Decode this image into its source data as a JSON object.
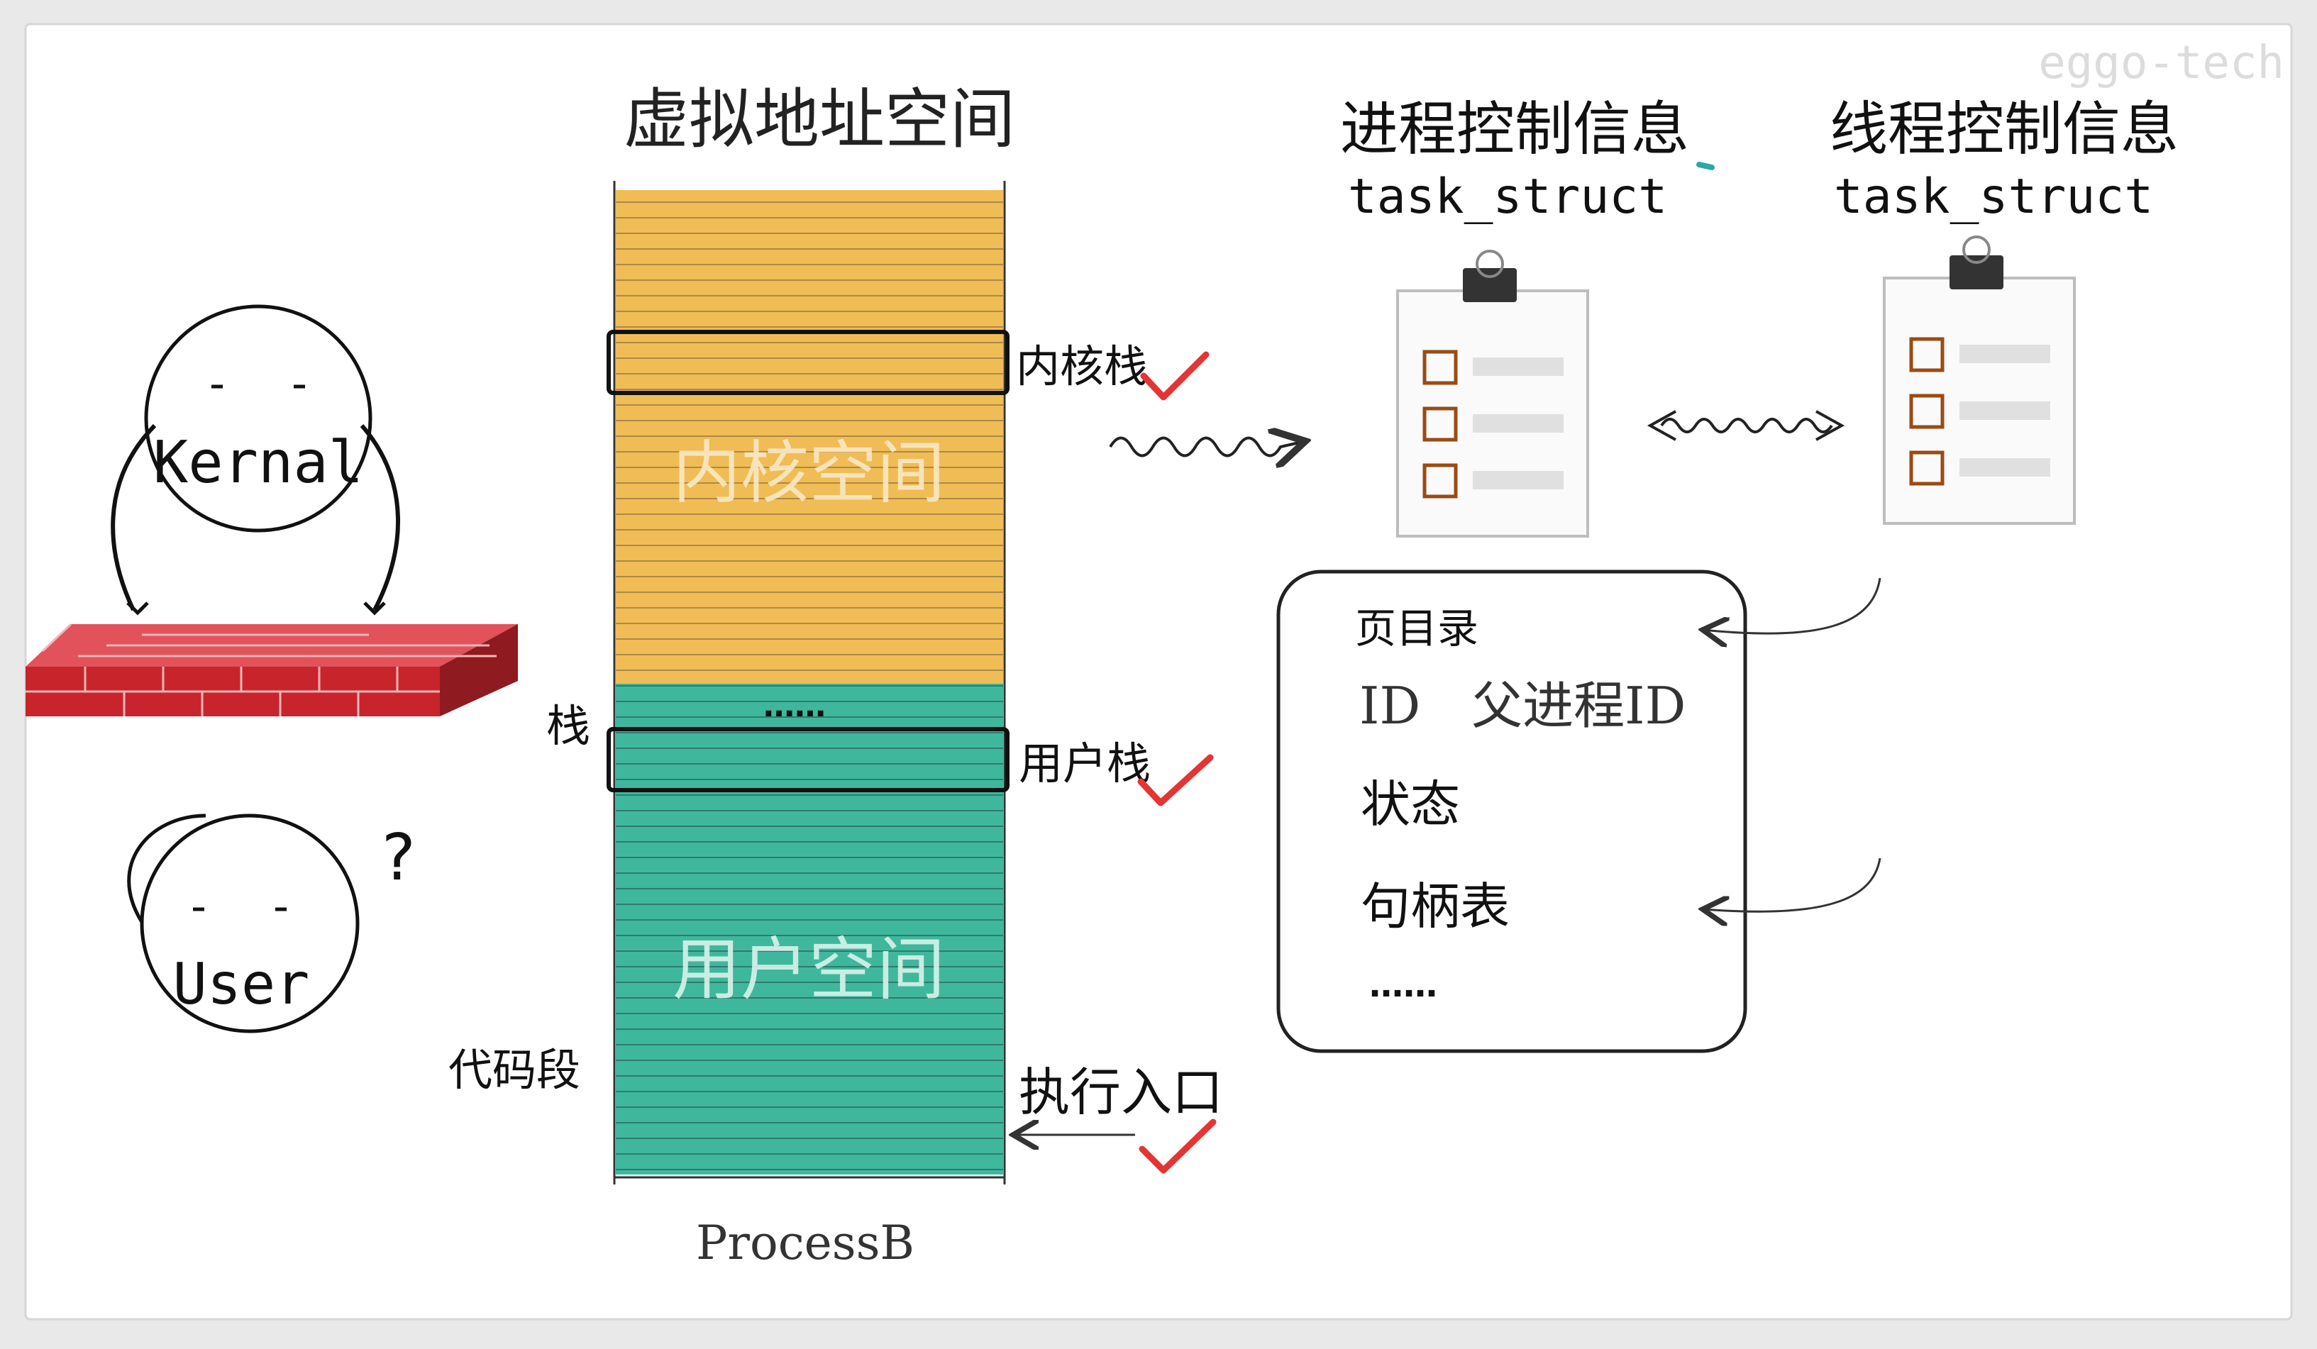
{
  "watermark": "eggo-tech",
  "virtual_address_space": {
    "title": "虚拟地址空间",
    "kernel_space_label": "内核空间",
    "user_space_label": "用户空间",
    "process_name": "ProcessB",
    "dots": "……",
    "colors": {
      "kernel": "#f0bc55",
      "user": "#3fb79d",
      "stripe": "#6b5a3a"
    }
  },
  "side_labels": {
    "kernel_stack": "内核栈",
    "user_stack": "用户栈",
    "stack": "栈",
    "code_segment": "代码段",
    "entry_point": "执行入口"
  },
  "characters": {
    "kernel": {
      "name": "Kernal"
    },
    "user": {
      "name": "User",
      "question": "?"
    }
  },
  "process_control": {
    "title": "进程控制信息",
    "subtitle": "task_struct"
  },
  "thread_control": {
    "title": "线程控制信息",
    "subtitle": "task_struct"
  },
  "info_box": {
    "items": [
      "页目录",
      "ID　父进程ID",
      "状态",
      "句柄表",
      "……"
    ]
  },
  "icons": [
    "clipboard-icon",
    "checkmark-icon",
    "brick-wall-icon",
    "wavy-arrow-icon",
    "double-arrow-icon",
    "curved-arrow-icon"
  ]
}
